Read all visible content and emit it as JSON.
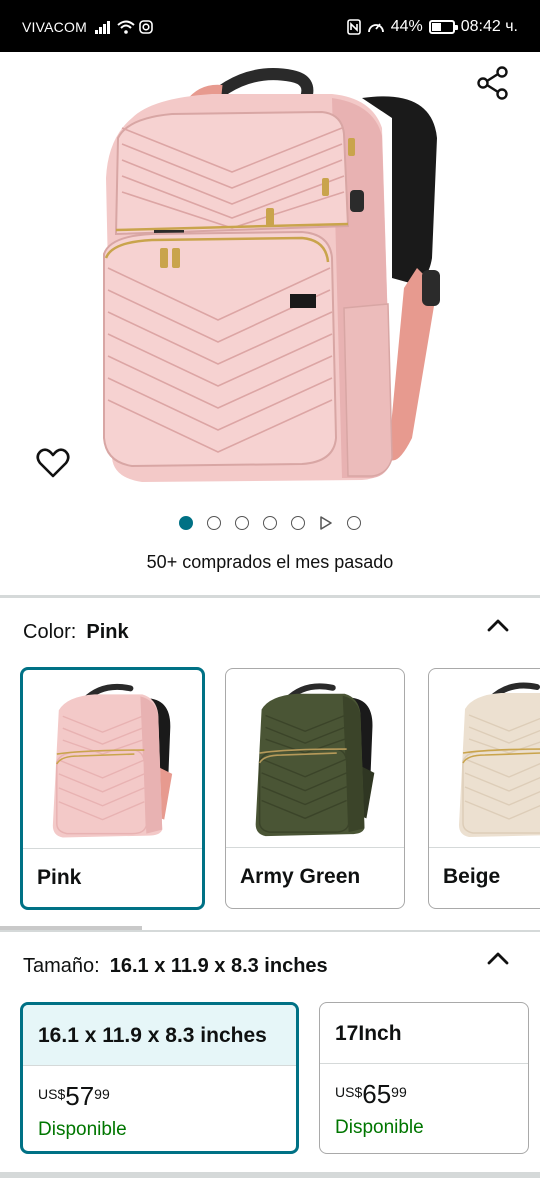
{
  "status_bar": {
    "carrier": "VIVACOM",
    "battery_percent": "44%",
    "battery_level": 0.44,
    "time": "08:42 ч."
  },
  "gallery": {
    "image_count": 7,
    "active_index": 0,
    "bought_text": "50+ comprados el mes pasado"
  },
  "color": {
    "label": "Color:",
    "selected": "Pink",
    "options": [
      {
        "label": "Pink",
        "selected": true,
        "body": "#f3c9c8",
        "shade": "#e8b2b2",
        "strap": "#e79a8f",
        "zip": "#c9a44c"
      },
      {
        "label": "Army Green",
        "selected": false,
        "body": "#4a5535",
        "shade": "#3b4429",
        "strap": "#2f3622",
        "zip": "#b69a5a"
      },
      {
        "label": "Beige",
        "selected": false,
        "body": "#ece0d0",
        "shade": "#ddcdb8",
        "strap": "#cdb69a",
        "zip": "#c9a44c"
      }
    ]
  },
  "size": {
    "label": "Tamaño:",
    "selected": "16.1 x 11.9 x 8.3 inches",
    "options": [
      {
        "label": "16.1 x 11.9 x 8.3 inches",
        "currency": "US$",
        "whole": "57",
        "fraction": "99",
        "availability": "Disponible",
        "selected": true
      },
      {
        "label": "17Inch",
        "currency": "US$",
        "whole": "65",
        "fraction": "99",
        "availability": "Disponible",
        "selected": false
      }
    ]
  },
  "icons": {
    "share": "share-icon",
    "favorite": "heart-icon",
    "collapse": "chevron-up-icon",
    "video": "play-icon"
  },
  "colors": {
    "accent": "#007185",
    "available": "#007600",
    "divider": "#d5d9d9"
  }
}
